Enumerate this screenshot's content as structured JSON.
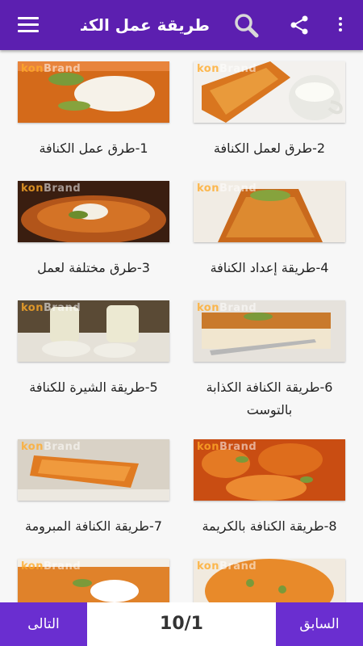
{
  "app_bar": {
    "title": "طريقة عمل الكنا...",
    "icons": [
      "more-vert-icon",
      "share-icon",
      "search-icon",
      "menu-icon"
    ],
    "background": "#5c1fb0"
  },
  "watermark": {
    "part1": "kon",
    "part2": "Brand"
  },
  "items": [
    {
      "label": "1-طرق عمل الكنافة"
    },
    {
      "label": "2-طرق لعمل الكنافة"
    },
    {
      "label": "3-طرق مختلفة لعمل"
    },
    {
      "label": "4-طريقة إعداد الكنافة"
    },
    {
      "label": "5-طريقة الشيرة للكنافة"
    },
    {
      "label": "6-طريقة الكنافة الكذابة بالتوست"
    },
    {
      "label": "7-طريقة الكنافة المبرومة"
    },
    {
      "label": "8-طريقة الكنافة بالكريمة"
    },
    {
      "label": ""
    },
    {
      "label": ""
    }
  ],
  "bottom_bar": {
    "next_label": "التالى",
    "prev_label": "السابق",
    "page_indicator": "10/1",
    "button_color": "#6a2ed0"
  }
}
